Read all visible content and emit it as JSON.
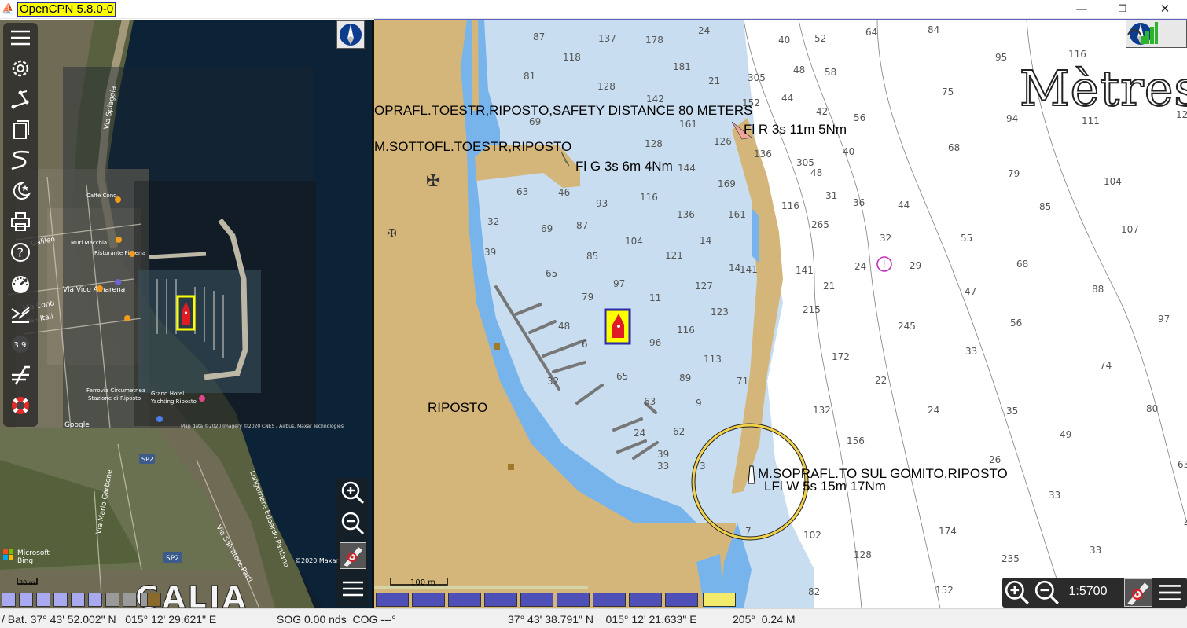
{
  "window": {
    "title": "OpenCPN 5.8.0-0",
    "icon": "opencpn-icon",
    "minimize": "—",
    "maximize": "❐",
    "close": "✕"
  },
  "toolbar": {
    "items": [
      "menu-icon",
      "settings-icon",
      "route-icon",
      "layers-icon",
      "track-icon",
      "tides-icon",
      "print-icon",
      "help-icon",
      "dashboard-icon",
      "ais-icon",
      "depth-icon",
      "grib-icon",
      "lifebuoy-icon"
    ],
    "depth_badge": "3.9"
  },
  "left_chart": {
    "provider": "Microsoft Bing",
    "copyright": "©2020 Maxar",
    "google": "Google",
    "imagery_note": "Map data ©2020 Imagery ©2020 CNES / Airbus, Maxar Technologies",
    "scale": "30 m",
    "overlay_label": "GALIA",
    "streets": [
      "Via Spiaggia",
      "Galileo",
      "Via Vico Amarena",
      "Via Conti",
      "Via Italia",
      "Via Mario Garbone",
      "Via Salvatore Patti",
      "Lungomare Edoardo Pantano",
      "SP2"
    ],
    "pois": [
      "Caffè Cono",
      "Muri Macchia",
      "Ristorante Pizzeria",
      "Ferrovia Circumetnea Stazione di Riposto",
      "Grand Hotel Yachting Riposto"
    ]
  },
  "right_chart": {
    "units_label": "Mètres",
    "scale": "100 m",
    "zoom_scale": "1:5700",
    "town": "RIPOSTO",
    "lights": [
      {
        "text": "OPRAFL.TOESTR,RIPOSTO,SAFETY DISTANCE 80 METERS"
      },
      {
        "text": "M.SOTTOFL.TOESTR,RIPOSTO"
      },
      {
        "text": "Fl G 3s 6m 4Nm"
      },
      {
        "text": "Fl R 3s 11m 5Nm"
      },
      {
        "text": "M.SOPRAFL.TO SUL GOMITO,RIPOSTO"
      },
      {
        "text": "LFl W 5s 15m 17Nm"
      }
    ],
    "soundings": [
      "87",
      "137",
      "178",
      "24",
      "40",
      "52",
      "64",
      "84",
      "118",
      "81",
      "181",
      "21",
      "305",
      "48",
      "58",
      "95",
      "116",
      "128",
      "75",
      "142",
      "152",
      "44",
      "69",
      "161",
      "42",
      "56",
      "94",
      "111",
      "126",
      "136",
      "305",
      "40",
      "68",
      "128",
      "144",
      "48",
      "79",
      "104",
      "63",
      "46",
      "93",
      "116",
      "169",
      "116",
      "31",
      "36",
      "44",
      "85",
      "32",
      "87",
      "136",
      "161",
      "265",
      "55",
      "107",
      "104",
      "69",
      "85",
      "121",
      "14",
      "32",
      "29",
      "24",
      "65",
      "97",
      "11",
      "127",
      "141",
      "141",
      "21",
      "68",
      "88",
      "39",
      "79",
      "123",
      "215",
      "245",
      "47",
      "56",
      "97",
      "48",
      "6",
      "96",
      "116",
      "33",
      "74",
      "113",
      "172",
      "22",
      "89",
      "65",
      "71",
      "9",
      "132",
      "24",
      "35",
      "80",
      "63",
      "62",
      "156",
      "49",
      "26",
      "63",
      "39",
      "24",
      "33",
      "102",
      "174",
      "128",
      "235",
      "33",
      "82",
      "152"
    ]
  },
  "zoom": {
    "zoom_in": "zoom-in-icon",
    "zoom_out": "zoom-out-icon",
    "follow": "follow-boat-icon",
    "menu": "menu-icon"
  },
  "status": {
    "bat": "/ Bat. 37° 43' 52.002\" N   015° 12' 29.621\" E",
    "sog": "SOG 0.00 nds  COG ---°",
    "cursor": "37° 43' 38.791\" N    015° 12' 21.633\" E",
    "bearing": "205°  0.24 M"
  },
  "colors": {
    "land": "#d4b67a",
    "shallow": "#78b4ec",
    "medium": "#a8cbe8",
    "deep": "#c8ddef",
    "deepest": "#ffffff",
    "ownship": "#e01b24",
    "highlight_left": "#ffff00",
    "highlight_right": "#2a2aaa",
    "title_bg": "#ffff00"
  }
}
